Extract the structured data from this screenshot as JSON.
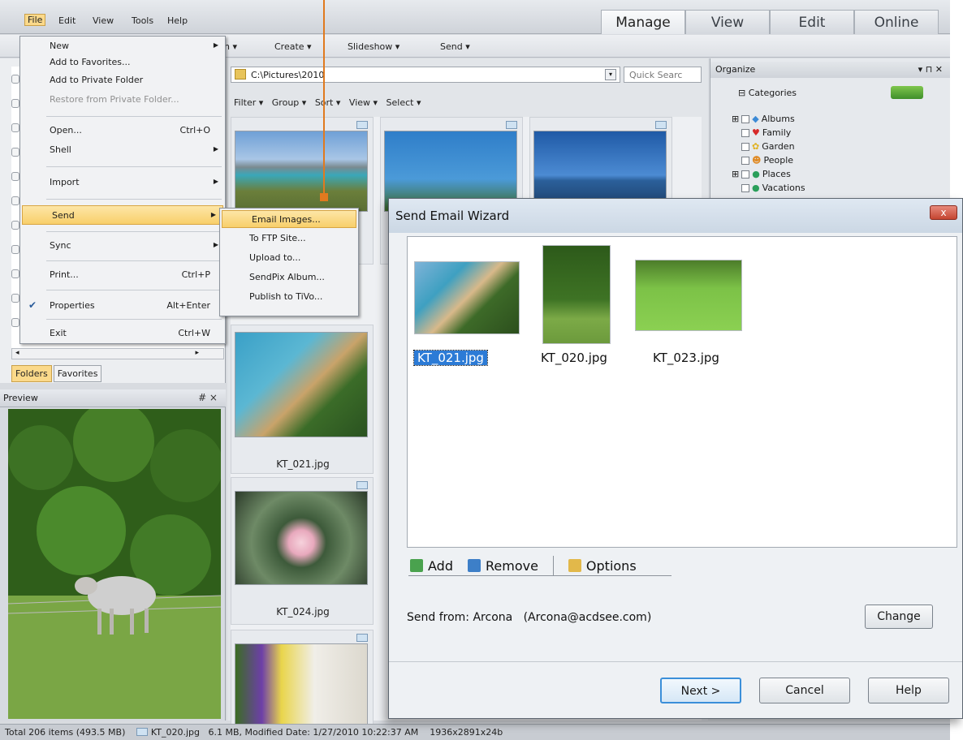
{
  "menubar": {
    "items": [
      "File",
      "Edit",
      "View",
      "Tools",
      "Help"
    ],
    "modes": [
      "Manage",
      "View",
      "Edit",
      "Online"
    ],
    "active_mode": "Manage"
  },
  "toolbar": {
    "items": [
      "ch",
      "Create",
      "Slideshow",
      "Send"
    ]
  },
  "file_menu": {
    "items": [
      {
        "label": "New",
        "shortcut": "",
        "submenu": true,
        "disabled": false
      },
      {
        "label": "Add to Favorites...",
        "shortcut": "",
        "submenu": false,
        "disabled": false
      },
      {
        "label": "Add to Private Folder",
        "shortcut": "",
        "submenu": false,
        "disabled": false
      },
      {
        "label": "Restore from Private Folder...",
        "shortcut": "",
        "submenu": false,
        "disabled": true
      },
      {
        "label": "Open...",
        "shortcut": "Ctrl+O",
        "submenu": false,
        "disabled": false
      },
      {
        "label": "Shell",
        "shortcut": "",
        "submenu": true,
        "disabled": false
      },
      {
        "label": "Import",
        "shortcut": "",
        "submenu": true,
        "disabled": false
      },
      {
        "label": "Send",
        "shortcut": "",
        "submenu": true,
        "disabled": false,
        "highlight": true
      },
      {
        "label": "Sync",
        "shortcut": "",
        "submenu": true,
        "disabled": false
      },
      {
        "label": "Print...",
        "shortcut": "Ctrl+P",
        "submenu": false,
        "disabled": false
      },
      {
        "label": "Properties",
        "shortcut": "Alt+Enter",
        "submenu": false,
        "disabled": false,
        "checked": true
      },
      {
        "label": "Exit",
        "shortcut": "Ctrl+W",
        "submenu": false,
        "disabled": false
      }
    ]
  },
  "send_submenu": {
    "items": [
      "Email Images...",
      "To FTP Site...",
      "Upload to...",
      "SendPix Album...",
      "Publish to TiVo..."
    ],
    "highlight_index": 0
  },
  "address": {
    "path": "C:\\Pictures\\2010",
    "quick_search_placeholder": "Quick Searc"
  },
  "filterbar": {
    "items": [
      "Filter",
      "Group",
      "Sort",
      "View",
      "Select"
    ]
  },
  "thumbnails": [
    {
      "label": "KT_021.jpg"
    },
    {
      "label": "KT_024.jpg"
    }
  ],
  "left_pane": {
    "tabs": [
      "Folders",
      "Favorites"
    ],
    "active_tab": "Folders"
  },
  "preview": {
    "title": "Preview",
    "controls": "# ×"
  },
  "organize": {
    "title": "Organize",
    "header": "Categories",
    "categories": [
      "Albums",
      "Family",
      "Garden",
      "People",
      "Places",
      "Vacations"
    ]
  },
  "dialog": {
    "title": "Send Email Wizard",
    "close": "x",
    "images": [
      {
        "label": "KT_021.jpg",
        "selected": true
      },
      {
        "label": "KT_020.jpg",
        "selected": false
      },
      {
        "label": "KT_023.jpg",
        "selected": false
      }
    ],
    "toolbar": {
      "add": "Add",
      "remove": "Remove",
      "options": "Options"
    },
    "send_from_label": "Send from:",
    "send_from_name": "Arcona",
    "send_from_email": "(Arcona@acdsee.com)",
    "change": "Change",
    "next": "Next >",
    "cancel": "Cancel",
    "help": "Help"
  },
  "status": {
    "total": "Total 206 items (493.5 MB)",
    "file": "KT_020.jpg",
    "details": "6.1 MB, Modified Date: 1/27/2010 10:22:37 AM",
    "dimensions": "1936x2891x24b"
  },
  "colors": {
    "accent": "#e07a1f",
    "menu_highlight": "#f8cf6a",
    "selection": "#2c7bd6"
  }
}
